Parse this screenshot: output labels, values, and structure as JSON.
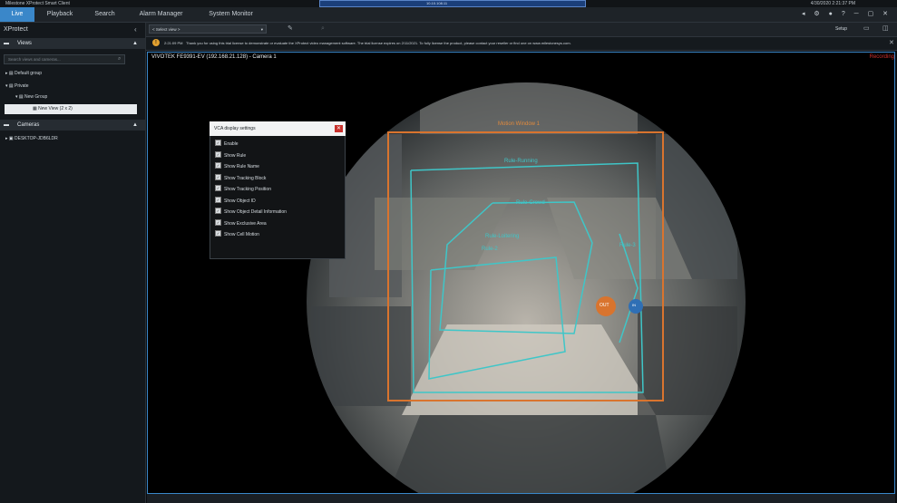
{
  "titlebar": {
    "app_title": "Milestone XProtect Smart Client",
    "remote_text": "10.10.108.11",
    "datetime": "4/30/2020 2:21:37 PM"
  },
  "tabs": [
    {
      "label": "Live",
      "active": true
    },
    {
      "label": "Playback",
      "active": false
    },
    {
      "label": "Search",
      "active": false
    },
    {
      "label": "Alarm Manager",
      "active": false
    },
    {
      "label": "System Monitor",
      "active": false
    }
  ],
  "sidebar": {
    "product": "XProtect",
    "views_header": "Views",
    "search_placeholder": "Search views and cameras...",
    "tree": [
      {
        "label": "Default group"
      },
      {
        "label": "Private"
      },
      {
        "label": "New Group"
      },
      {
        "label": "New View (2 x 2)"
      }
    ],
    "cameras_header": "Cameras",
    "camera_server": "DESKTOP-JDB6LDR"
  },
  "viewbar": {
    "select_view": "< Select view >",
    "setup": "Setup"
  },
  "notice": {
    "time": "2:21:09 PM",
    "text": "Thank you for using this trial license to demonstrate or evaluate the XProtect video management software. The trial license expires on 2/11/2021. To fully license the product, please contact your reseller or find one on www.milestonesys.com."
  },
  "camera": {
    "title": "VIVOTEK FE9391-EV (192.168.21.128) - Camera 1",
    "status": "Recording"
  },
  "overlays": {
    "motion_window": "Motion Window 1",
    "rule_running": "Rule-Running",
    "rule_crowd": "Rule-Crowd",
    "rule_loitering": "Rule-Loitering",
    "rule_2": "Rule-2",
    "rule_3": "Rule-3",
    "out": "OUT",
    "in": "IN"
  },
  "vca_dialog": {
    "title": "VCA display settings",
    "options": [
      {
        "label": "Enable",
        "checked": true
      },
      {
        "label": "Show Rule",
        "checked": true
      },
      {
        "label": "Show Rule Name",
        "checked": true
      },
      {
        "label": "Show Tracking Block",
        "checked": true
      },
      {
        "label": "Show Tracking Position",
        "checked": true
      },
      {
        "label": "Show Object ID",
        "checked": true
      },
      {
        "label": "Show Object Detail Information",
        "checked": true
      },
      {
        "label": "Show Exclusive Area",
        "checked": true
      },
      {
        "label": "Show Cell Motion",
        "checked": true
      }
    ]
  },
  "colors": {
    "accent": "#3a87c9",
    "motion_window": "#d9742e",
    "rule": "#3fc6c8",
    "recording": "#d0312d"
  }
}
